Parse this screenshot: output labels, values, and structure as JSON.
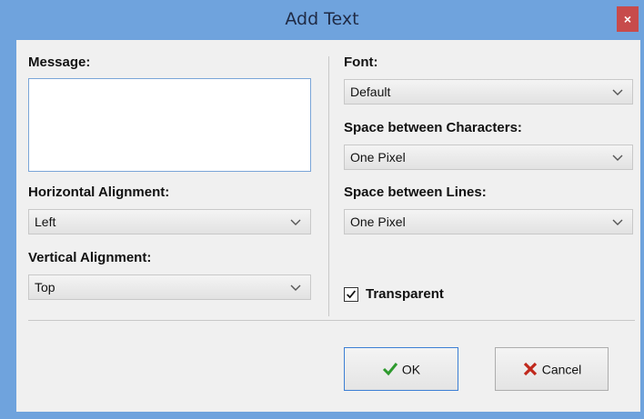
{
  "window": {
    "title": "Add Text",
    "close_glyph": "×"
  },
  "left": {
    "message_label": "Message:",
    "message_value": "",
    "horizontal_label": "Horizontal Alignment:",
    "horizontal_value": "Left",
    "vertical_label": "Vertical Alignment:",
    "vertical_value": "Top"
  },
  "right": {
    "font_label": "Font:",
    "font_value": "Default",
    "char_space_label": "Space between Characters:",
    "char_space_value": "One Pixel",
    "line_space_label": "Space between Lines:",
    "line_space_value": "One Pixel",
    "transparent_label": "Transparent",
    "transparent_checked": true
  },
  "buttons": {
    "ok_label": "OK",
    "cancel_label": "Cancel"
  },
  "colors": {
    "title_bg": "#6fa3dd",
    "close_bg": "#c74b4b",
    "ok_icon": "#2e9a2e",
    "cancel_icon": "#c0281c"
  },
  "icons": {
    "close": "close-icon",
    "dropdown": "chevron-down-icon",
    "ok": "checkmark-icon",
    "cancel": "x-icon",
    "checkbox": "checkmark-icon"
  }
}
